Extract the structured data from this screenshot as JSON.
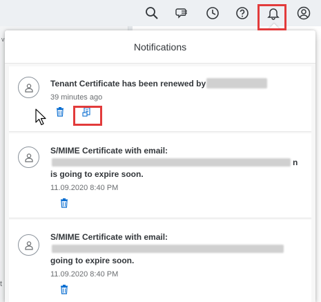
{
  "header": {
    "title": "Notifications"
  },
  "shellbar": {
    "icons": [
      "search-icon",
      "chat-icon",
      "clock-icon",
      "help-icon",
      "bell-icon",
      "user-icon"
    ]
  },
  "background": {
    "fragment_left": "v",
    "fragment_bottom": "t"
  },
  "notifications": [
    {
      "title": "Tenant Certificate has been renewed by",
      "time": "39 minutes ago"
    },
    {
      "title_line1": "S/MIME Certificate with email:",
      "title_tail": "n",
      "title_line2": "is going to expire soon.",
      "time": "11.09.2020 8:40 PM"
    },
    {
      "title_line1": "S/MIME Certificate with email:",
      "title_line2": "going to expire soon.",
      "time": "11.09.2020 8:40 PM"
    }
  ],
  "colors": {
    "accent": "#0a6ed1",
    "highlight": "#e23b3b",
    "text": "#32363a",
    "muted": "#6a6d70"
  }
}
